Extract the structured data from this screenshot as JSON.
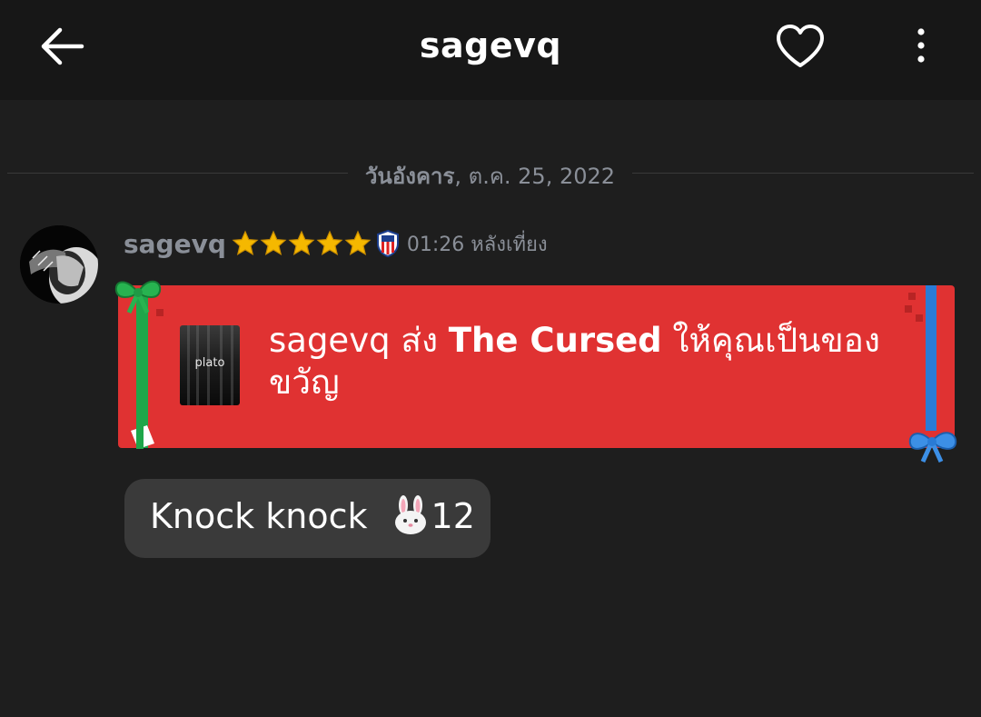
{
  "header": {
    "title": "sagevq",
    "back_icon": "arrow-left-icon",
    "favorite_icon": "heart-outline-icon",
    "more_icon": "more-vertical-icon"
  },
  "date_divider": {
    "weekday": "วันอังคาร",
    "date": ", ต.ค. 25, 2022"
  },
  "message_group": {
    "sender": "sagevq",
    "star_count": 5,
    "badge_icon": "shield-badge-icon",
    "time": "01:26 หลังเที่ยง"
  },
  "gift_message": {
    "cover_label": "plato",
    "sender": "sagevq",
    "verb": " ส่ง ",
    "book_title": "The Cursed",
    "suffix": " ให้คุณเป็นของขวัญ",
    "colors": {
      "card": "#e03232",
      "ribbon_left": "#1fa64a",
      "ribbon_right": "#2a7bd6"
    }
  },
  "text_message": {
    "text_prefix": "Knock knock ",
    "emoji_icon": "rabbit-face-icon",
    "text_suffix": "12"
  },
  "colors": {
    "background": "#1e1e1e",
    "topbar": "#171717",
    "muted_text": "#8a8f98",
    "bubble": "#3a3a3a",
    "star": "#f5b800"
  }
}
